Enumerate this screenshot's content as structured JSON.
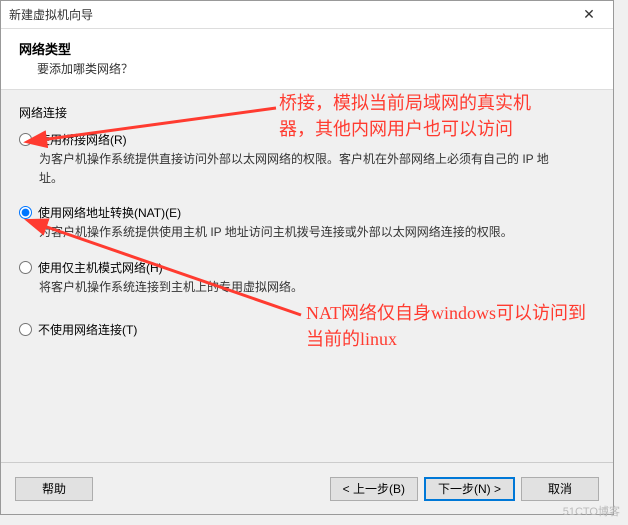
{
  "window": {
    "title": "新建虚拟机向导",
    "close_aria": "关闭"
  },
  "header": {
    "title": "网络类型",
    "subtitle": "要添加哪类网络？"
  },
  "group": {
    "label": "网络连接"
  },
  "options": {
    "bridged": {
      "label": "使用桥接网络(R)",
      "desc": "为客户机操作系统提供直接访问外部以太网网络的权限。客户机在外部网络上必须有自己的 IP 地址。"
    },
    "nat": {
      "label": "使用网络地址转换(NAT)(E)",
      "desc": "为客户机操作系统提供使用主机 IP 地址访问主机拨号连接或外部以太网网络连接的权限。"
    },
    "hostonly": {
      "label": "使用仅主机模式网络(H)",
      "desc": "将客户机操作系统连接到主机上的专用虚拟网络。"
    },
    "none": {
      "label": "不使用网络连接(T)"
    }
  },
  "buttons": {
    "help": "帮助",
    "back": "< 上一步(B)",
    "next": "下一步(N) >",
    "cancel": "取消"
  },
  "annotations": {
    "a1": "桥接，模拟当前局域网的真实机器，其他内网用户也可以访问",
    "a2": "NAT网络仅自身windows可以访问到当前的linux"
  },
  "watermark": "51CTO博客"
}
